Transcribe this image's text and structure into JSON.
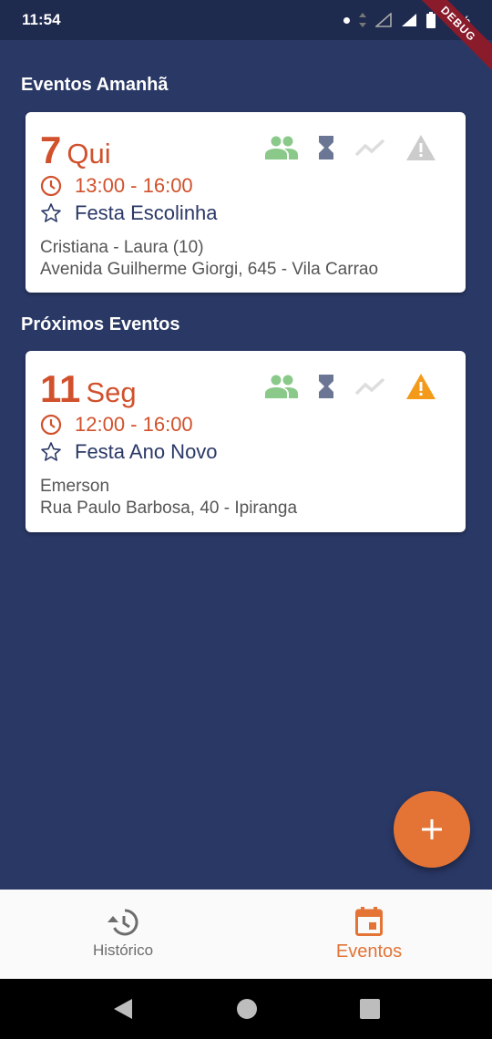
{
  "status_bar": {
    "time": "11:54",
    "battery": "77%"
  },
  "debug_label": "DEBUG",
  "sections": {
    "tomorrow_title": "Eventos Amanhã",
    "upcoming_title": "Próximos Eventos"
  },
  "events": [
    {
      "day": "7",
      "weekday": "Qui",
      "time": "13:00 - 16:00",
      "name": "Festa Escolinha",
      "people": "Cristiana - Laura (10)",
      "address": "Avenida Guilherme Giorgi, 645 - Vila Carrao",
      "warning_color": "#cccccc"
    },
    {
      "day": "11",
      "weekday": "Seg",
      "time": "12:00 - 16:00",
      "name": "Festa Ano Novo",
      "people": "Emerson",
      "address": "Rua Paulo Barbosa, 40 - Ipiranga",
      "warning_color": "#f39a1b"
    }
  ],
  "bottom_nav": {
    "history_label": "Histórico",
    "events_label": "Eventos"
  },
  "colors": {
    "background": "#2a3866",
    "accent": "#e37436",
    "date": "#d1512c",
    "people_icon": "#8bc98b",
    "hourglass_icon": "#6b7694",
    "trend_icon": "#dddddd"
  },
  "icons": [
    "people-icon",
    "hourglass-icon",
    "trending-icon",
    "warning-icon",
    "clock-icon",
    "star-icon",
    "history-icon",
    "calendar-icon",
    "add-icon"
  ]
}
